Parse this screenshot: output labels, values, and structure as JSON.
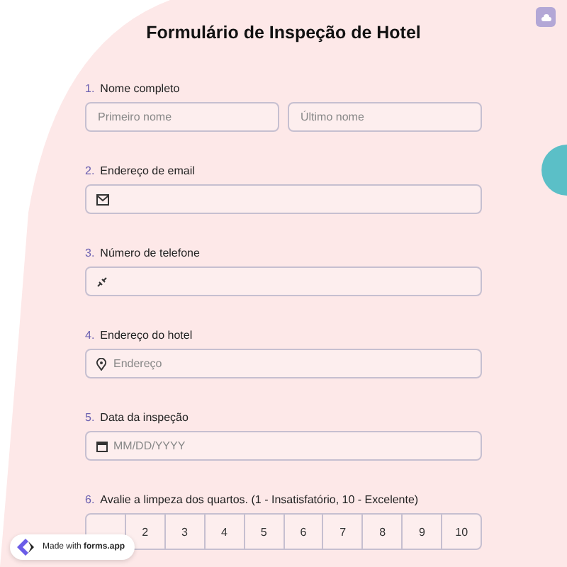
{
  "title": "Formulário de Inspeção de Hotel",
  "questions": [
    {
      "number": "1.",
      "label": "Nome completo",
      "kind": "name",
      "fields": [
        {
          "placeholder": "Primeiro nome"
        },
        {
          "placeholder": "Último nome"
        }
      ]
    },
    {
      "number": "2.",
      "label": "Endereço de email",
      "kind": "email"
    },
    {
      "number": "3.",
      "label": "Número de telefone",
      "kind": "phone"
    },
    {
      "number": "4.",
      "label": "Endereço do hotel",
      "kind": "address",
      "fields": [
        {
          "placeholder": "Endereço"
        }
      ]
    },
    {
      "number": "5.",
      "label": "Data da inspeção",
      "kind": "date",
      "fields": [
        {
          "placeholder": "MM/DD/YYYY"
        }
      ]
    },
    {
      "number": "6.",
      "label": "Avalie a limpeza dos quartos. (1 - Insatisfatório, 10 - Excelente)",
      "kind": "rating",
      "options": [
        "2",
        "3",
        "4",
        "5",
        "6",
        "7",
        "8",
        "9",
        "10"
      ]
    }
  ],
  "badge": "Made with **forms.app**"
}
